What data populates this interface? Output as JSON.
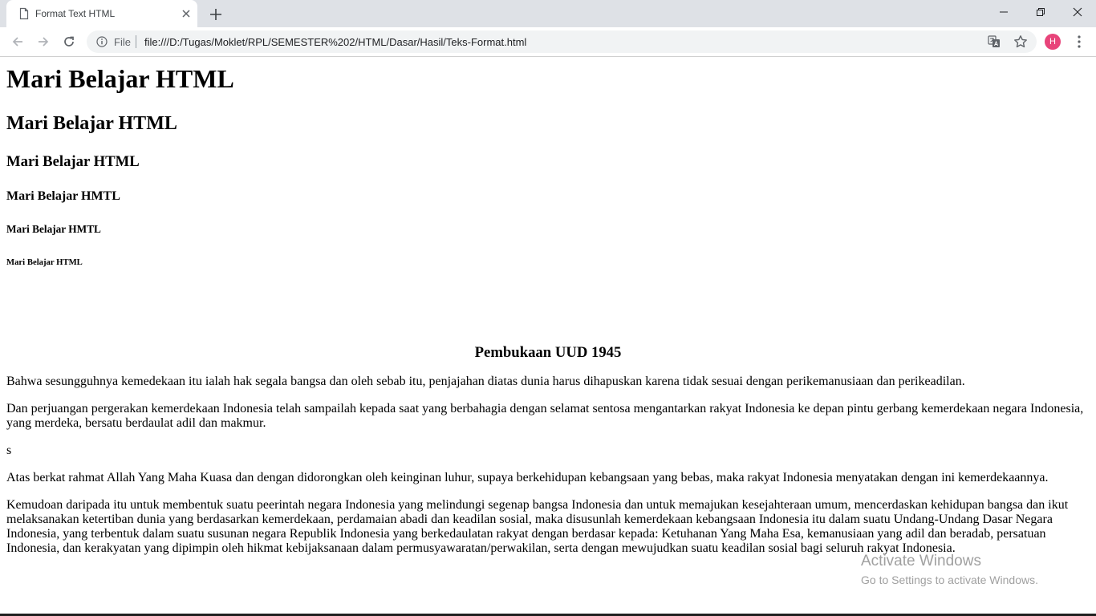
{
  "browser": {
    "tab_title": "Format Text HTML",
    "omnibox": {
      "scheme_label": "File",
      "url": "file:///D:/Tugas/Moklet/RPL/SEMESTER%202/HTML/Dasar/Hasil/Teks-Format.html"
    },
    "profile_initial": "H",
    "colors": {
      "tabstrip": "#dee1e6",
      "avatar": "#e8447a"
    }
  },
  "page": {
    "headings": [
      "Mari Belajar HTML",
      "Mari Belajar HTML",
      "Mari Belajar HTML",
      "Mari Belajar HMTL",
      "Mari Belajar HMTL",
      "Mari Belajar HTML"
    ],
    "subtitle": "Pembukaan UUD 1945",
    "paragraphs": [
      "Bahwa sesungguhnya kemedekaan itu ialah hak segala bangsa dan oleh sebab itu, penjajahan diatas dunia harus dihapuskan karena tidak sesuai dengan perikemanusiaan dan perikeadilan.",
      "Dan perjuangan pergerakan kemerdekaan Indonesia telah sampailah kepada saat yang berbahagia dengan selamat sentosa mengantarkan rakyat Indonesia ke depan pintu gerbang kemerdekaan negara Indonesia, yang merdeka, bersatu berdaulat adil dan makmur.",
      "s",
      "Atas berkat rahmat Allah Yang Maha Kuasa dan dengan didorongkan oleh keinginan luhur, supaya berkehidupan kebangsaan yang bebas, maka rakyat Indonesia menyatakan dengan ini kemerdekaannya.",
      "Kemudoan daripada itu untuk membentuk suatu peerintah negara Indonesia yang melindungi segenap bangsa Indonesia dan untuk memajukan kesejahteraan umum, mencerdaskan kehidupan bangsa dan ikut melaksanakan ketertiban dunia yang berdasarkan kemerdekaan, perdamaian abadi dan keadilan sosial, maka disusunlah kemerdekaan kebangsaan Indonesia itu dalam suatu Undang-Undang Dasar Negara Indonesia, yang terbentuk dalam suatu susunan negara Republik Indonesia yang berkedaulatan rakyat dengan berdasar kepada: Ketuhanan Yang Maha Esa, kemanusiaan yang adil dan beradab, persatuan Indonesia, dan kerakyatan yang dipimpin oleh hikmat kebijaksanaan dalam permusyawaratan/perwakilan, serta dengan mewujudkan suatu keadilan sosial bagi seluruh rakyat Indonesia."
    ]
  },
  "watermark": {
    "line1": "Activate Windows",
    "line2": "Go to Settings to activate Windows."
  }
}
